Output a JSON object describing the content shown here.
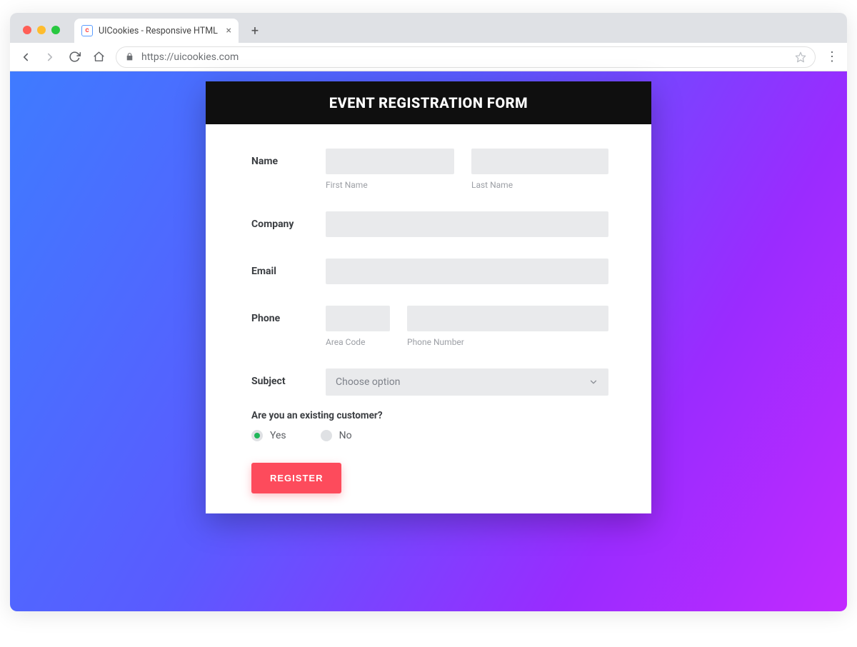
{
  "browser": {
    "tab_title": "UICookies - Responsive HTML",
    "url_display": "https://uicookies.com"
  },
  "form": {
    "title": "EVENT REGISTRATION FORM",
    "labels": {
      "name": "Name",
      "company": "Company",
      "email": "Email",
      "phone": "Phone",
      "subject": "Subject"
    },
    "hints": {
      "first_name": "First Name",
      "last_name": "Last Name",
      "area_code": "Area Code",
      "phone_number": "Phone Number"
    },
    "subject_selected": "Choose option",
    "existing_customer": {
      "question": "Are you an existing customer?",
      "options": {
        "yes": "Yes",
        "no": "No"
      },
      "selected": "yes"
    },
    "submit_label": "REGISTER"
  }
}
